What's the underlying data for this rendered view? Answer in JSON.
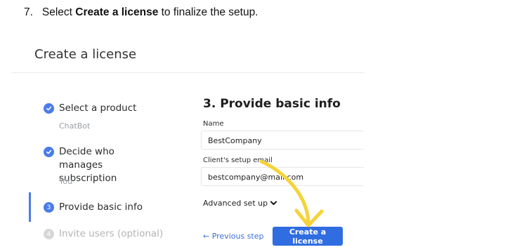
{
  "instruction": {
    "number": "7.",
    "pre": "Select",
    "bold": "Create a license",
    "post": "to finalize the setup."
  },
  "dialog": {
    "title": "Create a license"
  },
  "steps": [
    {
      "label": "Select a product",
      "sub": "ChatBot",
      "status": "done"
    },
    {
      "label": "Decide who manages subscription",
      "sub": "You",
      "status": "done"
    },
    {
      "label": "Provide basic info",
      "number": "3",
      "status": "current"
    },
    {
      "label": "Invite users (optional)",
      "number": "4",
      "status": "todo"
    }
  ],
  "form": {
    "title": "3. Provide basic info",
    "name_label": "Name",
    "name_value": "BestCompany",
    "email_label": "Client's setup email",
    "email_value": "bestcompany@mail.com",
    "advanced_label": "Advanced set up",
    "prev_label": "← Previous step",
    "create_label": "Create a license"
  },
  "colors": {
    "accent": "#2f6de1",
    "highlight_arrow": "#f6d33b"
  }
}
